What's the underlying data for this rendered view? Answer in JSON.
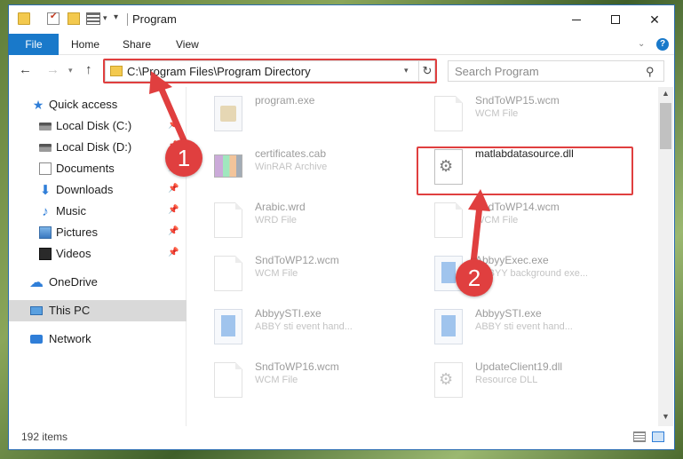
{
  "window": {
    "title": "Program"
  },
  "ribbon": {
    "file": "File",
    "home": "Home",
    "share": "Share",
    "view": "View",
    "help": "?"
  },
  "nav": {
    "address": "C:\\Program Files\\Program Directory",
    "search_placeholder": "Search Program"
  },
  "sidebar": {
    "items": [
      {
        "label": "Quick access",
        "icon": "star-icon",
        "pinned": false
      },
      {
        "label": "Local Disk (C:)",
        "icon": "disk-icon",
        "pinned": true
      },
      {
        "label": "Local Disk (D:)",
        "icon": "disk-icon",
        "pinned": true
      },
      {
        "label": "Documents",
        "icon": "documents-icon",
        "pinned": true
      },
      {
        "label": "Downloads",
        "icon": "download-icon",
        "pinned": true
      },
      {
        "label": "Music",
        "icon": "music-icon",
        "pinned": true
      },
      {
        "label": "Pictures",
        "icon": "pictures-icon",
        "pinned": true
      },
      {
        "label": "Videos",
        "icon": "videos-icon",
        "pinned": true
      },
      {
        "label": "OneDrive",
        "icon": "onedrive-icon",
        "pinned": false
      },
      {
        "label": "This PC",
        "icon": "pc-icon",
        "pinned": false,
        "selected": true
      },
      {
        "label": "Network",
        "icon": "network-icon",
        "pinned": false
      }
    ]
  },
  "files": [
    {
      "name": "program.exe",
      "desc": "",
      "icon": "program-icon",
      "faded": true
    },
    {
      "name": "SndToWP15.wcm",
      "desc": "WCM File",
      "icon": "document-icon",
      "faded": true
    },
    {
      "name": "certificates.cab",
      "desc": "WinRAR Archive",
      "icon": "archive-icon",
      "faded": true
    },
    {
      "name": "matlabdatasource.dll",
      "desc": "",
      "icon": "dll-gear-icon",
      "faded": false
    },
    {
      "name": "Arabic.wrd",
      "desc": "WRD File",
      "icon": "document-icon",
      "faded": true
    },
    {
      "name": "SndToWP14.wcm",
      "desc": "WCM File",
      "icon": "document-icon",
      "faded": true
    },
    {
      "name": "SndToWP12.wcm",
      "desc": "WCM File",
      "icon": "document-icon",
      "faded": true
    },
    {
      "name": "AbbyyExec.exe",
      "desc": "ABBYY background exe...",
      "icon": "exe-icon",
      "faded": true
    },
    {
      "name": "AbbyySTI.exe",
      "desc": "ABBY sti event hand...",
      "icon": "exe-icon",
      "faded": true
    },
    {
      "name": "AbbyySTI.exe",
      "desc": "ABBY sti event hand...",
      "icon": "exe-icon",
      "faded": true
    },
    {
      "name": "SndToWP16.wcm",
      "desc": "WCM File",
      "icon": "document-icon",
      "faded": true
    },
    {
      "name": "UpdateClient19.dll",
      "desc": "Resource DLL",
      "icon": "dll-gear-icon",
      "faded": true
    }
  ],
  "status": {
    "count": "192 items"
  },
  "annotations": {
    "step1": "1",
    "step2": "2",
    "color": "#e03f3f"
  }
}
